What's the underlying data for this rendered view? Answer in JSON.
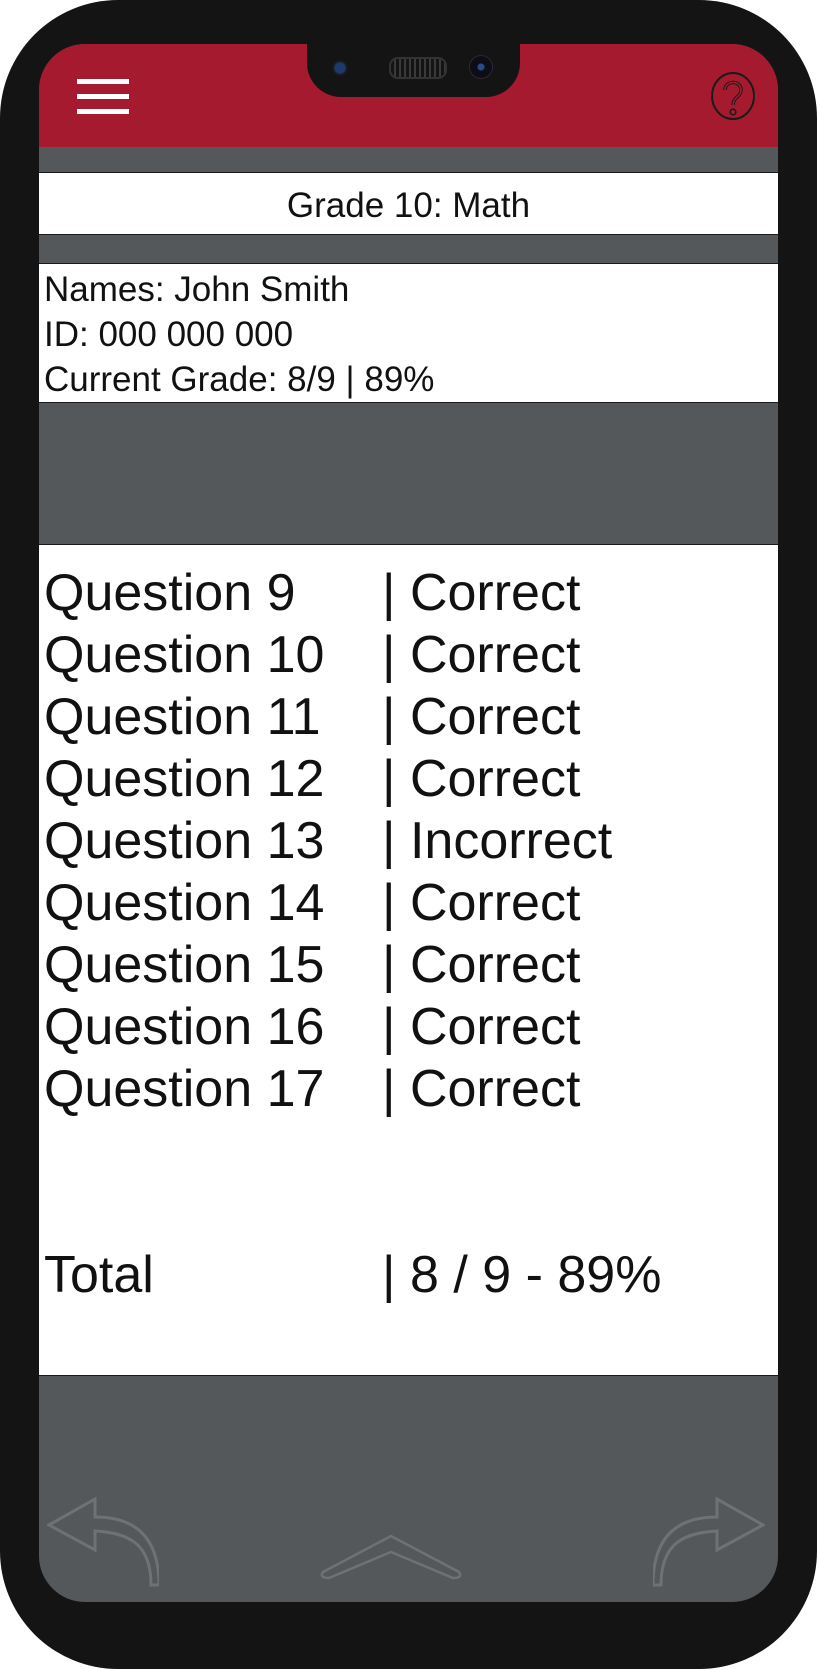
{
  "header": {
    "menu_icon": "hamburger-menu-icon",
    "help_icon": "question-mark-help-icon",
    "accent_color": "#a51a2e"
  },
  "page": {
    "title": "Grade 10: Math"
  },
  "student": {
    "name_line": "Names: John Smith",
    "id_line": "ID: 000 000 000",
    "grade_line": "Current Grade: 8/9 | 89%"
  },
  "results": {
    "rows": [
      {
        "question": "Question 9",
        "result": "| Correct"
      },
      {
        "question": "Question 10",
        "result": "| Correct"
      },
      {
        "question": "Question 11",
        "result": "| Correct"
      },
      {
        "question": "Question 12",
        "result": "| Correct"
      },
      {
        "question": "Question 13",
        "result": "| Incorrect"
      },
      {
        "question": "Question 14",
        "result": "| Correct"
      },
      {
        "question": "Question 15",
        "result": "| Correct"
      },
      {
        "question": "Question 16",
        "result": "| Correct"
      },
      {
        "question": "Question 17",
        "result": "| Correct"
      }
    ],
    "total_label": "Total",
    "total_value": "| 8 / 9 - 89%"
  },
  "navigation": {
    "back_icon": "back-arrow-icon",
    "home_icon": "chevron-up-icon",
    "forward_icon": "forward-arrow-icon"
  }
}
